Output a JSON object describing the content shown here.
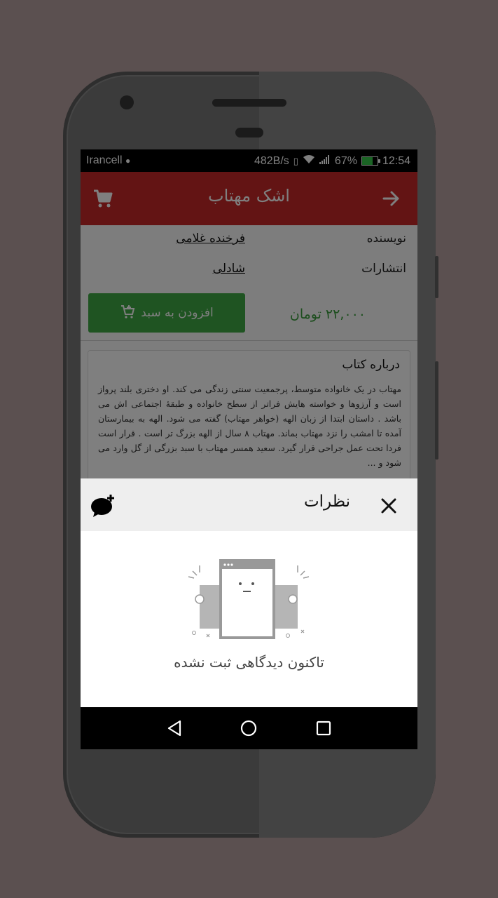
{
  "status_bar": {
    "carrier": "Irancell",
    "speed": "482B/s",
    "battery": "67%",
    "time": "12:54"
  },
  "app_bar": {
    "title": "اشک مهتاب",
    "back_icon": "arrow-right-icon",
    "cart_icon": "cart-icon"
  },
  "book": {
    "author_label": "نویسنده",
    "author": "فرخنده غلامی",
    "publisher_label": "انتشارات",
    "publisher": "شادلی",
    "price": "۲۲,۰۰۰ تومان",
    "add_to_cart": "افزودن به سبد"
  },
  "about": {
    "heading": "درباره کتاب",
    "text": "مهتاب در یک خانواده متوسط، پرجمعیت سنتی زندگی می کند. او دختری بلند پرواز است و آرزوها و خواسته هایش فراتر از سطح خانواده و طبقهٔ اجتماعی اش می باشد . داستان ابتدا از زبان الهه (خواهر مهتاب) گفته می شود. الهه به بیمارستان آمده تا امشب را نزد مهتاب بماند. مهتاب ۸ سال از الهه بزرگ تر است . قرار است فردا تحت عمل جراحی قرار گیرد. سعید همسر مهتاب با سبد بزرگی از گل وارد می شود و ..."
  },
  "comments": {
    "title": "نظرات",
    "empty_text": "تاکنون دیدگاهی ثبت نشده",
    "close_icon": "close-icon",
    "add_icon": "add-comment-icon"
  },
  "colors": {
    "primary": "#c62828",
    "accent_green": "#3fa945",
    "price_green": "#3a9c3d"
  }
}
